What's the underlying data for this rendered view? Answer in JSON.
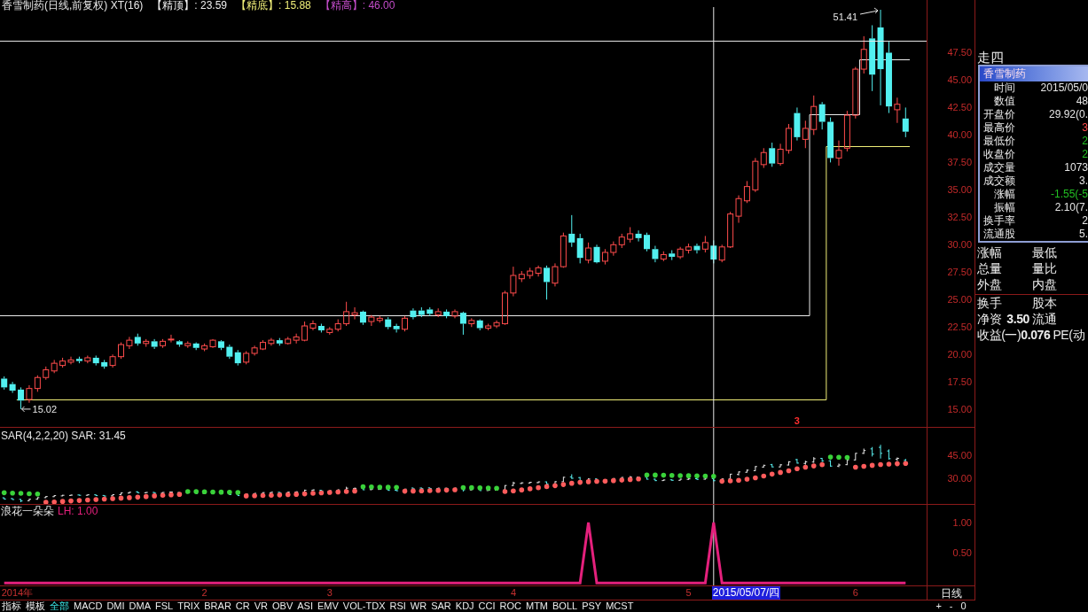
{
  "title": {
    "text": "香雪制药(日线,前复权) XT(16)",
    "legend": [
      {
        "label": "【精顶】: 23.59",
        "color": "#ececec"
      },
      {
        "label": "【精底】: 15.88",
        "color": "#f0ee78"
      },
      {
        "label": "【精高】: 46.00",
        "color": "#c24cc8"
      }
    ]
  },
  "price_chart": {
    "axis_labels": [
      "47.50",
      "45.00",
      "42.50",
      "40.00",
      "37.50",
      "35.00",
      "32.50",
      "30.00",
      "27.50",
      "25.00",
      "22.50",
      "20.00",
      "17.50",
      "15.00"
    ],
    "high_label": "51.41",
    "low_label": "15.02",
    "signal_marker": "3"
  },
  "sar_panel": {
    "title": "SAR(4,2,2,20) SAR: 31.45",
    "axis_labels": [
      "45.00",
      "30.00"
    ]
  },
  "lh_panel": {
    "title": "浪花一朵朵",
    "reading": "LH: 1.00",
    "chart_data": {
      "type": "line",
      "ylim": [
        -0.04,
        1.29
      ],
      "yticks": [
        {
          "value": 0.5,
          "label": "0.50"
        },
        {
          "value": 1,
          "label": "1.00"
        }
      ],
      "series": [
        {
          "color": "#e4207c",
          "values": [
            0,
            0,
            0,
            0,
            0,
            0,
            0,
            0,
            0,
            0,
            0,
            0,
            0,
            0,
            0,
            0,
            0,
            0,
            0,
            0,
            0,
            0,
            0,
            0,
            0,
            0,
            0,
            0,
            0,
            0,
            0,
            0,
            0,
            0,
            0,
            0,
            0,
            0,
            0,
            0,
            0,
            0,
            0,
            0,
            0,
            0,
            0,
            0,
            0,
            0,
            0,
            0,
            0,
            0,
            0,
            0,
            0,
            0,
            0,
            0,
            0,
            0,
            0,
            0,
            0,
            0,
            0,
            0,
            0,
            0,
            1,
            0,
            0,
            0,
            0,
            0,
            0,
            0,
            0,
            0,
            0,
            0,
            0,
            0,
            0,
            1,
            0,
            0,
            0,
            0,
            0,
            0,
            0,
            0,
            0,
            0,
            0,
            0,
            0,
            0,
            0,
            0,
            0,
            0,
            0,
            0,
            0,
            0,
            0
          ]
        }
      ]
    }
  },
  "date_axis": {
    "labels": [
      "2014年",
      "2",
      "3",
      "4",
      "5",
      "6"
    ],
    "cursor_label": "2015/05/07/四",
    "period": "日线"
  },
  "zoom_controls": [
    "+",
    "-",
    "0"
  ],
  "indicator_tabs": [
    {
      "label": "指标",
      "selected": false
    },
    {
      "label": "模板",
      "selected": false
    },
    {
      "label": "全部",
      "selected": true
    },
    {
      "label": "MACD",
      "selected": false
    },
    {
      "label": "DMI",
      "selected": false
    },
    {
      "label": "DMA",
      "selected": false
    },
    {
      "label": "FSL",
      "selected": false
    },
    {
      "label": "TRIX",
      "selected": false
    },
    {
      "label": "BRAR",
      "selected": false
    },
    {
      "label": "CR",
      "selected": false
    },
    {
      "label": "VR",
      "selected": false
    },
    {
      "label": "OBV",
      "selected": false
    },
    {
      "label": "ASI",
      "selected": false
    },
    {
      "label": "EMV",
      "selected": false
    },
    {
      "label": "VOL-TDX",
      "selected": false
    },
    {
      "label": "RSI",
      "selected": false
    },
    {
      "label": "WR",
      "selected": false
    },
    {
      "label": "SAR",
      "selected": false
    },
    {
      "label": "KDJ",
      "selected": false
    },
    {
      "label": "CCI",
      "selected": false
    },
    {
      "label": "ROC",
      "selected": false
    },
    {
      "label": "MTM",
      "selected": false
    },
    {
      "label": "BOLL",
      "selected": false
    },
    {
      "label": "PSY",
      "selected": false
    },
    {
      "label": "MCST",
      "selected": false
    }
  ],
  "info_panel": {
    "weekday": "走四",
    "popup": {
      "title": "香雪制药",
      "rows": [
        {
          "label": "时间",
          "value": "2015/05/0",
          "color": "#e6e6e6"
        },
        {
          "label": "数值",
          "value": "48",
          "color": "#e6e6e6"
        },
        {
          "label": "开盘价",
          "value": "29.92(0.",
          "color": "#e6e6e6"
        },
        {
          "label": "最高价",
          "value": "3",
          "color": "#ff4a4a"
        },
        {
          "label": "最低价",
          "value": "2",
          "color": "#22c022"
        },
        {
          "label": "收盘价",
          "value": "2",
          "color": "#22c022"
        },
        {
          "label": "成交量",
          "value": "1073",
          "color": "#e6e6e6"
        },
        {
          "label": "成交额",
          "value": "3.",
          "color": "#e6e6e6"
        },
        {
          "label": "涨幅",
          "value": "-1.55(-5",
          "color": "#22c022"
        },
        {
          "label": "振幅",
          "value": "2.10(7.",
          "color": "#e6e6e6"
        },
        {
          "label": "换手率",
          "value": "2",
          "color": "#e6e6e6"
        },
        {
          "label": "流通股",
          "value": "5.",
          "color": "#e6e6e6"
        }
      ]
    },
    "quote_groups": [
      [
        {
          "label": "涨幅",
          "label2": "最低"
        },
        {
          "label": "总量",
          "label2": "量比"
        },
        {
          "label": "外盘",
          "label2": "内盘"
        }
      ],
      [
        {
          "label": "换手",
          "label2": "股本"
        },
        {
          "label": "净资",
          "value": "3.50",
          "label2": "流通"
        },
        {
          "label": "收益(一)",
          "value": "0.076",
          "label2": "PE(动"
        }
      ]
    ]
  }
}
